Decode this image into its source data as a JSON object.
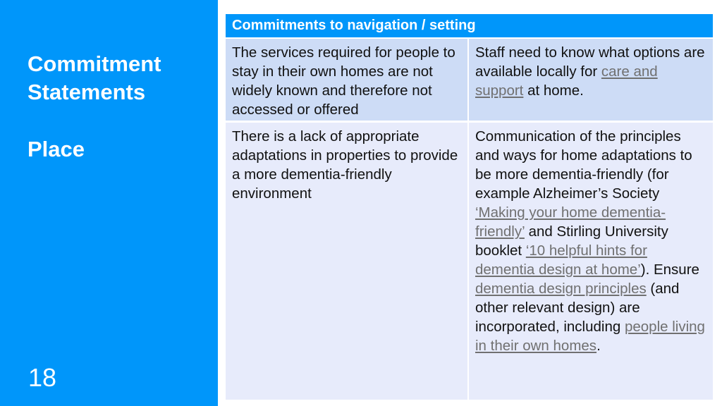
{
  "sidebar": {
    "title_line1": "Commitment",
    "title_line2": "Statements",
    "subtitle": "Place",
    "page_number": "18",
    "background_color": "#0096fa"
  },
  "table": {
    "header": "Commitments to navigation / setting",
    "header_color": "#0096fa",
    "rows": [
      {
        "issue": "The services required for people to stay in their own homes are not widely known and therefore not accessed or offered",
        "commitment": {
          "before": "Staff need to know what options are available locally for ",
          "link1": "care and support",
          "after": " at home."
        }
      },
      {
        "issue": "There is a lack of appropriate adaptations in properties to provide a more dementia-friendly environment",
        "commitment": {
          "t1": "Communication of the principles and ways for home adaptations to be more dementia-friendly (for example Alzheimer’s Society ",
          "link1": "‘Making your home dementia-friendly’",
          "t2": " and Stirling University booklet ",
          "link2": "‘10 helpful hints for dementia design at home’",
          "t3": "). Ensure ",
          "link3": "dementia design principles",
          "t4": " (and other relevant design) are incorporated, including ",
          "link4": "people living in their own homes",
          "t5": "."
        }
      }
    ]
  }
}
